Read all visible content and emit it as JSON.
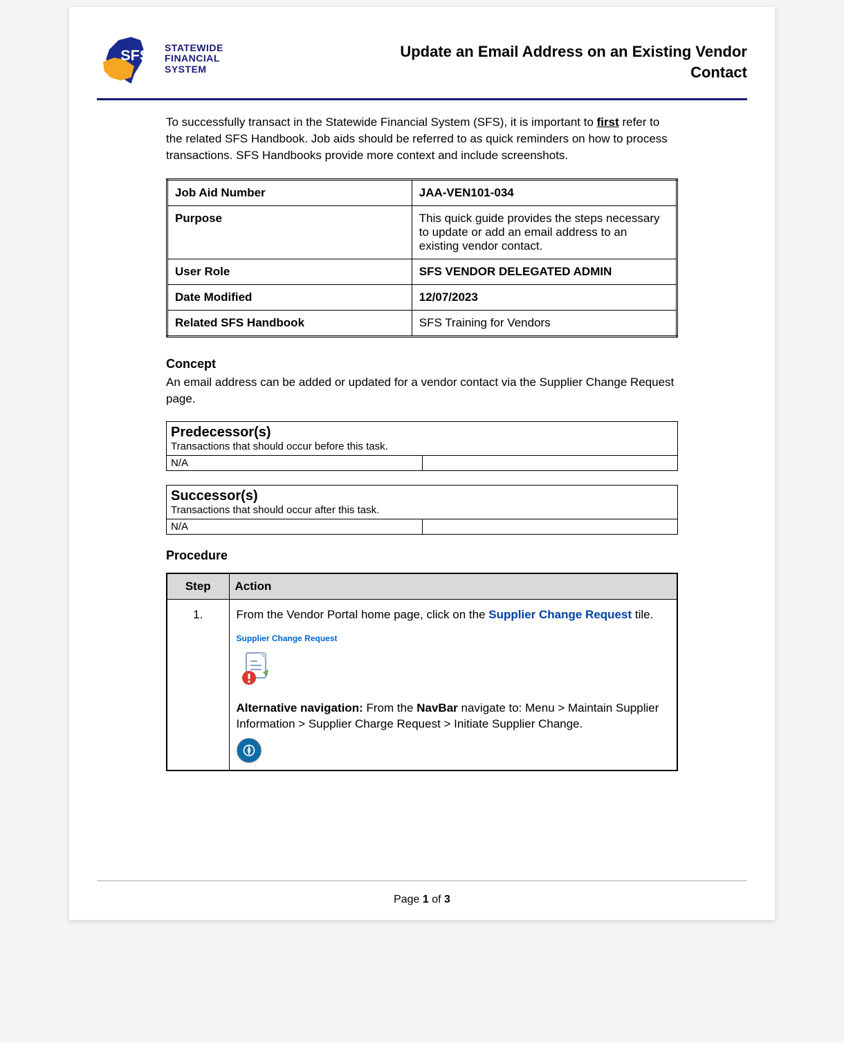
{
  "logo": {
    "line1": "STATEWIDE",
    "line2": "FINANCIAL",
    "line3": "SYSTEM"
  },
  "title": "Update an Email Address on an Existing Vendor Contact",
  "intro": {
    "prefix": "To successfully transact in the Statewide Financial System (SFS), it is important to ",
    "emphasis": "first",
    "suffix": " refer to the related SFS Handbook. Job aids should be referred to as quick reminders on how to process transactions. SFS Handbooks provide more context and include screenshots."
  },
  "info_table": [
    {
      "label": "Job Aid Number",
      "value": "JAA-VEN101-034",
      "value_bold": true
    },
    {
      "label": "Purpose",
      "value": "This quick guide provides the steps necessary to update or add an email address to an existing vendor contact.",
      "value_bold": false
    },
    {
      "label": "User Role",
      "value": "SFS VENDOR DELEGATED ADMIN",
      "value_bold": true
    },
    {
      "label": "Date Modified",
      "value": "12/07/2023",
      "value_bold": true
    },
    {
      "label": "Related SFS Handbook",
      "value": "SFS Training for Vendors",
      "value_bold": false
    }
  ],
  "concept": {
    "heading": "Concept",
    "text": "An email address can be added or updated for a vendor contact via the Supplier Change Request page."
  },
  "predecessor": {
    "heading": "Predecessor(s)",
    "subhead": "Transactions that should occur before this task.",
    "left": "N/A",
    "right": ""
  },
  "successor": {
    "heading": "Successor(s)",
    "subhead": "Transactions that should occur after this task.",
    "left": "N/A",
    "right": ""
  },
  "procedure": {
    "heading": "Procedure",
    "columns": {
      "step": "Step",
      "action": "Action"
    },
    "rows": [
      {
        "step": "1.",
        "action_prefix": "From the Vendor Portal home page, click on the ",
        "action_link": "Supplier Change Request",
        "action_suffix": " tile.",
        "tile_caption": "Supplier Change Request",
        "alt_prefix": "Alternative navigation:",
        "alt_mid1": " From the ",
        "alt_navbar": "NavBar",
        "alt_rest": " navigate to: Menu > Maintain Supplier Information > Supplier Charge Request > Initiate Supplier Change."
      }
    ]
  },
  "footer": {
    "prefix": "Page ",
    "current": "1",
    "mid": " of ",
    "total": "3"
  }
}
